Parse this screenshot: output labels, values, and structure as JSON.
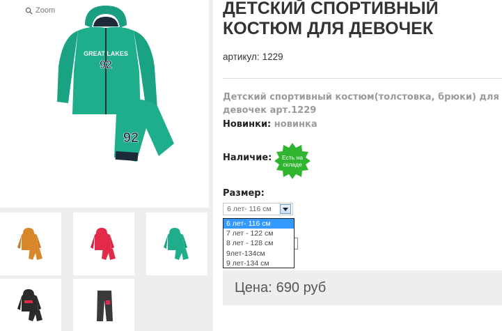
{
  "gallery": {
    "zoom_label": "Zoom",
    "thumbnails": [
      {
        "name": "thumb-orange",
        "color": "#d8872a"
      },
      {
        "name": "thumb-red",
        "color": "#e32a4a"
      },
      {
        "name": "thumb-green",
        "color": "#1fae8c"
      },
      {
        "name": "thumb-black",
        "color": "#2b2b2b"
      },
      {
        "name": "thumb-pants",
        "color": "#3a3a3a"
      }
    ],
    "main_print_text": "GREAT LAKES",
    "main_number": "92"
  },
  "product": {
    "title": "ДЕТСКИЙ СПОРТИВНЫЙ КОСТЮМ ДЛЯ ДЕВОЧЕК",
    "sku_label": "артикул:",
    "sku_value": "1229",
    "description": "Детский спортивный костюм(толстовка, брюки) для девочек арт.1229",
    "new_label": "Новинки:",
    "new_value": "новинка",
    "availability_label": "Наличие:",
    "availability_badge": "Есть на складе",
    "size_label": "Размер:",
    "size_selected": "6 лет- 116 см",
    "size_options": [
      "6 лет- 116 см",
      "7 лет - 122 см",
      "8 лет - 128 см",
      "9лет-134см",
      "9 лет-134 см"
    ],
    "price_label": "Цена:",
    "price_value": "690 руб"
  },
  "colors": {
    "suit_green": "#1fae8c",
    "badge_green": "#2fb52f",
    "select_highlight": "#3399ff",
    "muted_text": "#9a9a9a"
  }
}
